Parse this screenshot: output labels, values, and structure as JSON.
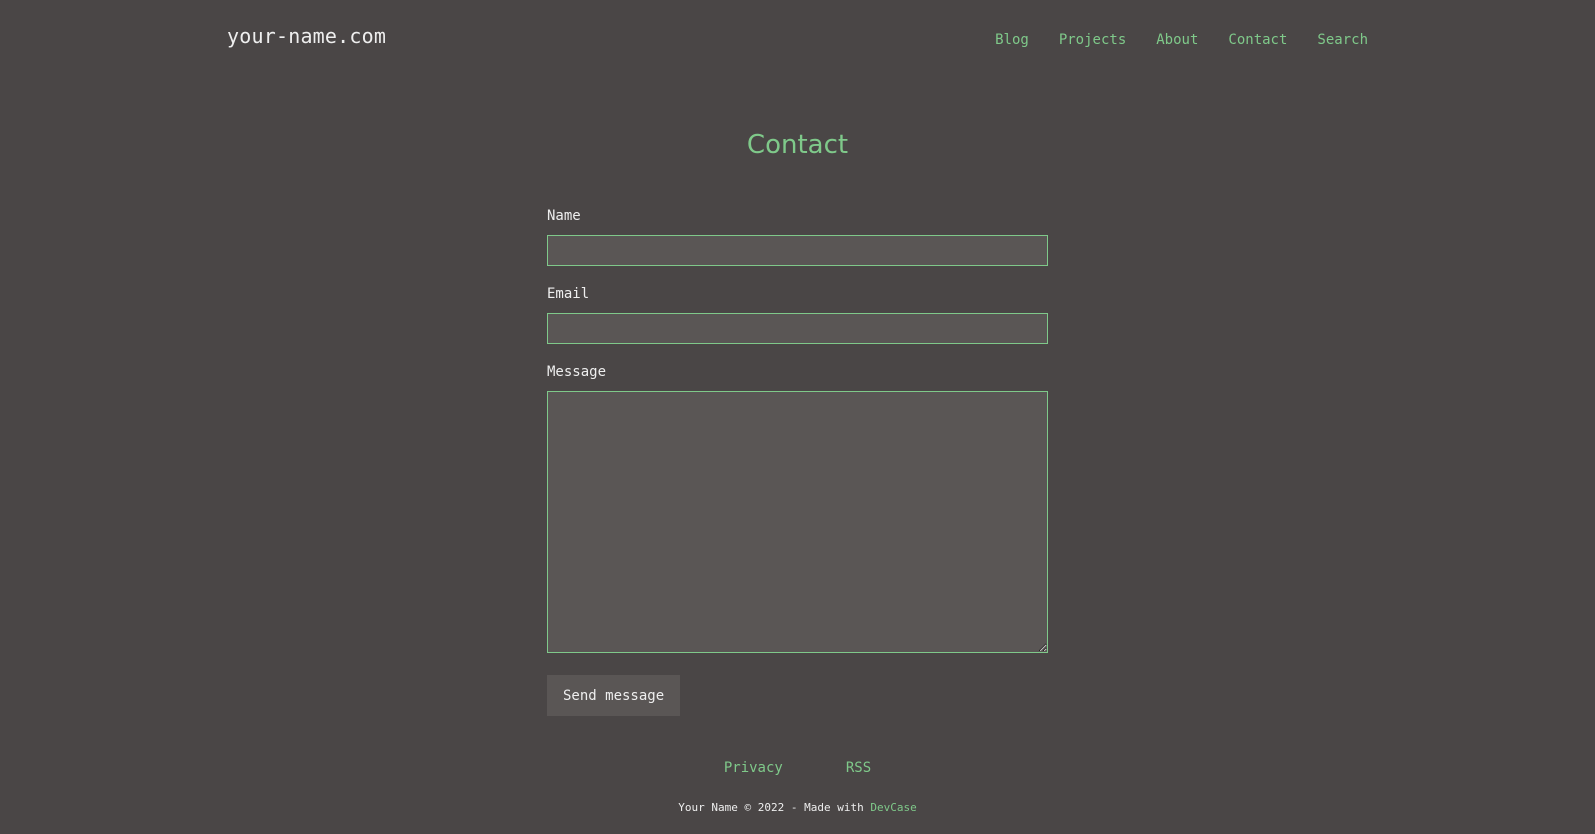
{
  "header": {
    "site_title": "your-name.com",
    "nav": [
      {
        "label": "Blog"
      },
      {
        "label": "Projects"
      },
      {
        "label": "About"
      },
      {
        "label": "Contact"
      },
      {
        "label": "Search"
      }
    ]
  },
  "main": {
    "title": "Contact",
    "form": {
      "name_label": "Name",
      "name_value": "",
      "email_label": "Email",
      "email_value": "",
      "message_label": "Message",
      "message_value": "",
      "submit_label": "Send message"
    }
  },
  "footer": {
    "links": [
      {
        "label": "Privacy"
      },
      {
        "label": "RSS"
      }
    ],
    "copyright_text": "Your Name © 2022 - Made with ",
    "made_with_link": "DevCase"
  },
  "colors": {
    "background": "#4a4646",
    "accent": "#7fc98a",
    "text": "#eeeeee",
    "field_background": "#5a5655"
  }
}
